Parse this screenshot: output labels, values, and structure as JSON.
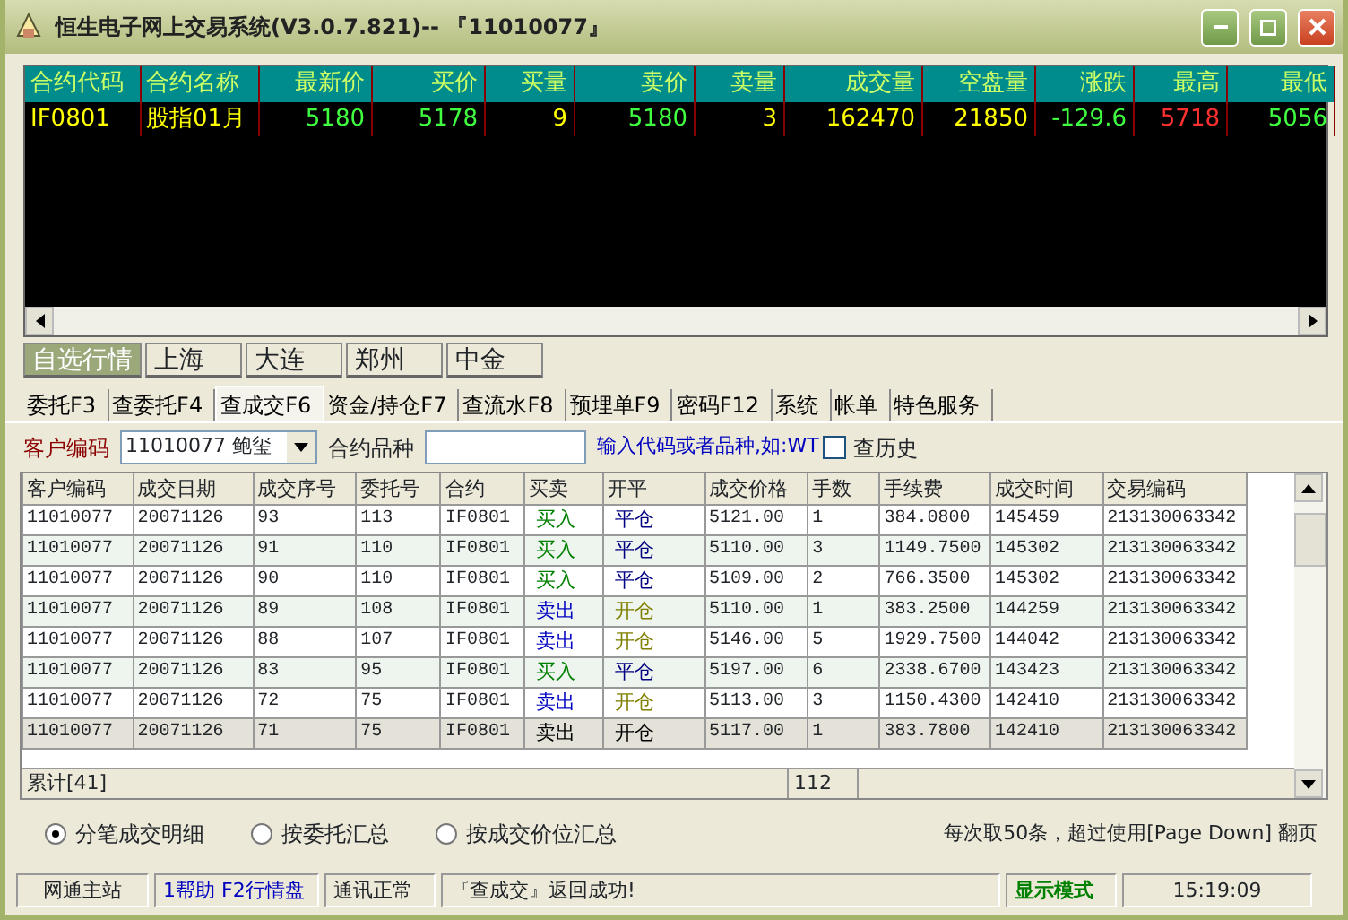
{
  "window": {
    "title": "恒生电子网上交易系统(V3.0.7.821)-- 『11010077』"
  },
  "quotes": {
    "columns": [
      "合约代码",
      "合约名称",
      "最新价",
      "买价",
      "买量",
      "卖价",
      "卖量",
      "成交量",
      "空盘量",
      "涨跌",
      "最高",
      "最低"
    ],
    "rows": [
      {
        "cells": [
          {
            "text": "IF0801",
            "color": "#ffff00"
          },
          {
            "text": "股指01月",
            "color": "#ffff00"
          },
          {
            "text": "5180",
            "color": "#40ff40"
          },
          {
            "text": "5178",
            "color": "#40ff40"
          },
          {
            "text": "9",
            "color": "#ffff00"
          },
          {
            "text": "5180",
            "color": "#40ff40"
          },
          {
            "text": "3",
            "color": "#ffff00"
          },
          {
            "text": "162470",
            "color": "#ffff00"
          },
          {
            "text": "21850",
            "color": "#ffff00"
          },
          {
            "text": "-129.6",
            "color": "#40ff40"
          },
          {
            "text": "5718",
            "color": "#ff3030"
          },
          {
            "text": "5056",
            "color": "#40ff40"
          }
        ]
      }
    ]
  },
  "market_tabs": [
    {
      "label": "自选行情",
      "selected": true
    },
    {
      "label": "上海",
      "selected": false
    },
    {
      "label": "大连",
      "selected": false
    },
    {
      "label": "郑州",
      "selected": false
    },
    {
      "label": "中金",
      "selected": false
    }
  ],
  "function_tabs": [
    {
      "label": "委托F3",
      "selected": false
    },
    {
      "label": "查委托F4",
      "selected": false
    },
    {
      "label": "查成交F6",
      "selected": true
    },
    {
      "label": "资金/持仓F7",
      "selected": false
    },
    {
      "label": "查流水F8",
      "selected": false
    },
    {
      "label": "预埋单F9",
      "selected": false
    },
    {
      "label": "密码F12",
      "selected": false
    },
    {
      "label": "系统",
      "selected": false
    },
    {
      "label": "帐单",
      "selected": false
    },
    {
      "label": "特色服务",
      "selected": false
    }
  ],
  "filter": {
    "client_label": "客户编码",
    "client_value": "11010077 鲍玺",
    "contract_label": "合约品种",
    "hint": "输入代码或者品种,如:WT",
    "history_label": "查历史",
    "history_checked": false
  },
  "trades": {
    "columns": [
      "客户编码",
      "成交日期",
      "成交序号",
      "委托号",
      "合约",
      "买卖",
      "开平",
      "成交价格",
      "手数",
      "手续费",
      "成交时间",
      "交易编码"
    ],
    "rows": [
      {
        "selected": false,
        "cells": [
          "11010077",
          "20071126",
          "93",
          "113",
          "IF0801",
          {
            "text": "买入",
            "color": "#008000"
          },
          {
            "text": "平仓",
            "color": "#000080"
          },
          "5121.00",
          "1",
          "384.0800",
          "145459",
          "213130063342"
        ]
      },
      {
        "selected": false,
        "cells": [
          "11010077",
          "20071126",
          "91",
          "110",
          "IF0801",
          {
            "text": "买入",
            "color": "#008000"
          },
          {
            "text": "平仓",
            "color": "#000080"
          },
          "5110.00",
          "3",
          "1149.7500",
          "145302",
          "213130063342"
        ]
      },
      {
        "selected": false,
        "cells": [
          "11010077",
          "20071126",
          "90",
          "110",
          "IF0801",
          {
            "text": "买入",
            "color": "#008000"
          },
          {
            "text": "平仓",
            "color": "#000080"
          },
          "5109.00",
          "2",
          "766.3500",
          "145302",
          "213130063342"
        ]
      },
      {
        "selected": false,
        "cells": [
          "11010077",
          "20071126",
          "89",
          "108",
          "IF0801",
          {
            "text": "卖出",
            "color": "#0000c0"
          },
          {
            "text": "开仓",
            "color": "#808000"
          },
          "5110.00",
          "1",
          "383.2500",
          "144259",
          "213130063342"
        ]
      },
      {
        "selected": false,
        "cells": [
          "11010077",
          "20071126",
          "88",
          "107",
          "IF0801",
          {
            "text": "卖出",
            "color": "#0000c0"
          },
          {
            "text": "开仓",
            "color": "#808000"
          },
          "5146.00",
          "5",
          "1929.7500",
          "144042",
          "213130063342"
        ]
      },
      {
        "selected": false,
        "cells": [
          "11010077",
          "20071126",
          "83",
          "95",
          "IF0801",
          {
            "text": "买入",
            "color": "#008000"
          },
          {
            "text": "平仓",
            "color": "#000080"
          },
          "5197.00",
          "6",
          "2338.6700",
          "143423",
          "213130063342"
        ]
      },
      {
        "selected": false,
        "cells": [
          "11010077",
          "20071126",
          "72",
          "75",
          "IF0801",
          {
            "text": "卖出",
            "color": "#0000c0"
          },
          {
            "text": "开仓",
            "color": "#808000"
          },
          "5113.00",
          "3",
          "1150.4300",
          "142410",
          "213130063342"
        ]
      },
      {
        "selected": true,
        "cells": [
          "11010077",
          "20071126",
          "71",
          "75",
          "IF0801",
          {
            "text": "卖出",
            "color": "#000000"
          },
          {
            "text": "开仓",
            "color": "#000000"
          },
          "5117.00",
          "1",
          "383.7800",
          "142410",
          "213130063342"
        ]
      }
    ],
    "total_label": "累计[41]",
    "total_lots": "112"
  },
  "view_options": [
    {
      "label": "分笔成交明细",
      "selected": true
    },
    {
      "label": "按委托汇总",
      "selected": false
    },
    {
      "label": "按成交价位汇总",
      "selected": false
    }
  ],
  "page_note": "每次取50条，超过使用[Page Down] 翻页",
  "status_bar": {
    "station": "网通主站",
    "help": "1帮助 F2行情盘",
    "connection": "通讯正常",
    "message": "『查成交』返回成功!",
    "mode": "显示模式",
    "time": "15:19:09"
  }
}
